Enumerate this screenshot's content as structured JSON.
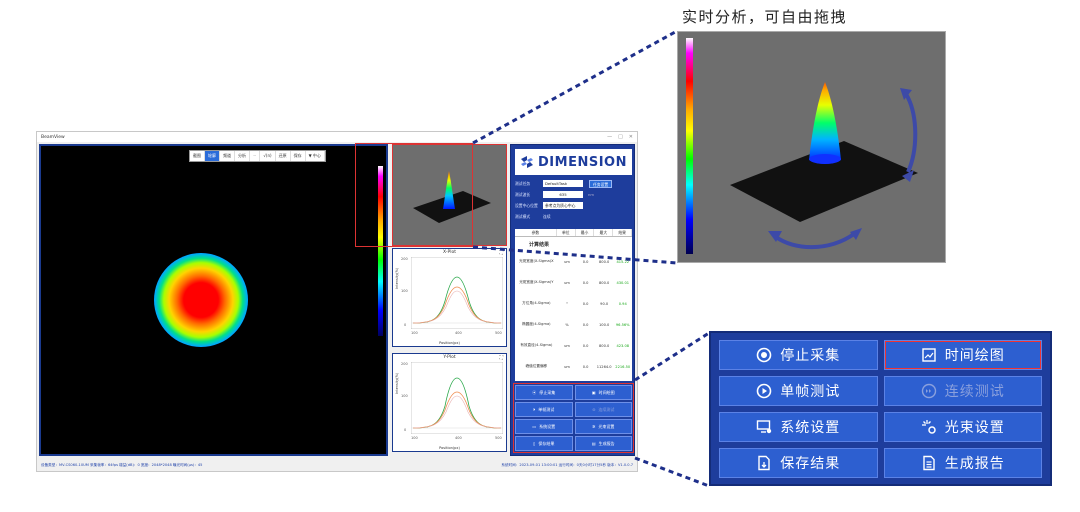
{
  "callout_caption": "实时分析，可自由拖拽",
  "window": {
    "title": "BeamView",
    "controls": [
      "—",
      "□",
      "✕"
    ]
  },
  "camera_toolbar": [
    {
      "label": "截图",
      "state": "normal"
    },
    {
      "label": "轮廓",
      "state": "active"
    },
    {
      "label": "频道",
      "state": "normal"
    },
    {
      "label": "分析",
      "state": "normal"
    },
    {
      "label": "~",
      "state": "disabled"
    },
    {
      "label": "√(n)",
      "state": "normal"
    },
    {
      "label": "还原",
      "state": "normal"
    },
    {
      "label": "保存",
      "state": "normal"
    },
    {
      "label": "▼ 中心",
      "state": "normal"
    }
  ],
  "logo": {
    "text": "DIMENSION"
  },
  "params": [
    {
      "label": "测试任务",
      "value": "DefaultTask",
      "button": "任务设置"
    },
    {
      "label": "测试波长",
      "value": "635",
      "unit": "nm"
    },
    {
      "label": "设置中心位置",
      "value": "参考点为质心中心"
    },
    {
      "label": "测试模式",
      "plain": "连续"
    }
  ],
  "results": {
    "headers": [
      "参数",
      "单位",
      "最小",
      "最大",
      "结果"
    ],
    "title": "计算结果",
    "rows": [
      {
        "name": "光斑宽度(X-Sigma)X",
        "unit": "um",
        "min": "0.0",
        "max": "800.0",
        "result": "415.22"
      },
      {
        "name": "光斑宽度(X-Sigma)Y",
        "unit": "um",
        "min": "0.0",
        "max": "800.0",
        "result": "430.01"
      },
      {
        "name": "方位角(4-Sigma)",
        "unit": "°",
        "min": "0.0",
        "max": "90.0",
        "result": "0.94"
      },
      {
        "name": "椭圆度(4-Sigma)",
        "unit": "%",
        "min": "0.0",
        "max": "100.0",
        "result": "96.56%"
      },
      {
        "name": "有效直径(4-Sigma)",
        "unit": "um",
        "min": "0.0",
        "max": "800.0",
        "result": "423.08"
      },
      {
        "name": "峰值位置偏移",
        "unit": "um",
        "min": "0.0",
        "max": "11264.0",
        "result": "2216.50"
      }
    ]
  },
  "buttons": [
    {
      "label": "停止采集",
      "icon": "stop-circle-icon",
      "state": "normal"
    },
    {
      "label": "时间绘图",
      "icon": "chart-icon",
      "state": "selected"
    },
    {
      "label": "单帧测试",
      "icon": "play-circle-icon",
      "state": "normal"
    },
    {
      "label": "连续测试",
      "icon": "continuous-icon",
      "state": "disabled"
    },
    {
      "label": "系统设置",
      "icon": "monitor-settings-icon",
      "state": "normal"
    },
    {
      "label": "光束设置",
      "icon": "beam-settings-icon",
      "state": "normal"
    },
    {
      "label": "保存结果",
      "icon": "save-file-icon",
      "state": "normal"
    },
    {
      "label": "生成报告",
      "icon": "report-icon",
      "state": "normal"
    }
  ],
  "plots": [
    {
      "title": "X-Plot",
      "xlabel": "Position(px)",
      "ylabel": "Intensity(%)",
      "xticks": [
        "100",
        "400",
        "500"
      ],
      "yticks": [
        "200",
        "100",
        "0"
      ]
    },
    {
      "title": "Y-Plot",
      "xlabel": "Position(px)",
      "ylabel": "Intensity(%)",
      "xticks": [
        "100",
        "400",
        "500"
      ],
      "yticks": [
        "200",
        "100",
        "0"
      ]
    }
  ],
  "statusbar": {
    "left": "设备类型：MV-CS060-10UM  采集帧率：64fps  增益(dB)：0  宽度：2048*2048  曝光时间(μs)：45",
    "right": "系统时间：2023-09-01 13:00:01  运行时间：0天0小时17分5秒  版本：V1.0.0.7"
  },
  "colors": {
    "panel": "#1e3d9c",
    "button": "#2d5fd0",
    "accent_red": "#dd3333",
    "connector": "#1e2f8a"
  }
}
